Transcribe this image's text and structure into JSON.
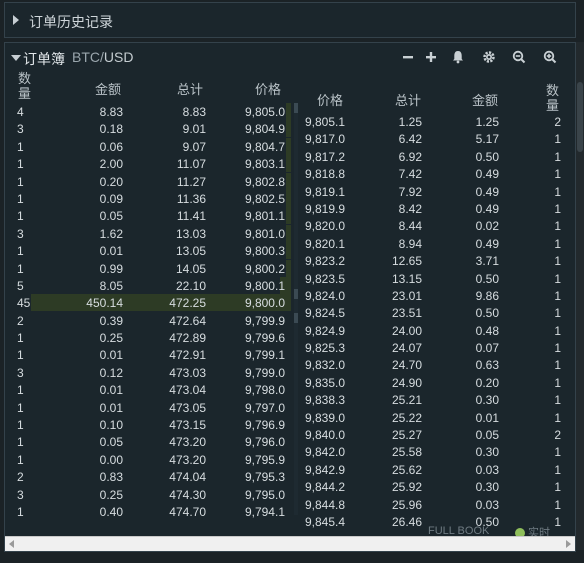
{
  "history": {
    "title": "订单历史记录"
  },
  "book": {
    "title": "订单簿",
    "pair_base": "BTC",
    "pair_sep": "/",
    "pair_quote": "USD",
    "tools": [
      "minus-icon",
      "plus-icon",
      "bell-icon",
      "gear-icon",
      "zoom-out-icon",
      "zoom-in-icon"
    ],
    "bid_headers": {
      "count": "数量",
      "amount": "金额",
      "total": "总计",
      "price": "价格"
    },
    "ask_headers": {
      "price": "价格",
      "total": "总计",
      "amount": "金额",
      "count": "数量"
    },
    "bids": [
      {
        "count": "4",
        "amount": "8.83",
        "total": "8.83",
        "price": "9,805.0",
        "bar": 0.02
      },
      {
        "count": "3",
        "amount": "0.18",
        "total": "9.01",
        "price": "9,804.9",
        "bar": 0.02
      },
      {
        "count": "1",
        "amount": "0.06",
        "total": "9.07",
        "price": "9,804.7",
        "bar": 0.02
      },
      {
        "count": "1",
        "amount": "2.00",
        "total": "11.07",
        "price": "9,803.1",
        "bar": 0.02
      },
      {
        "count": "1",
        "amount": "0.20",
        "total": "11.27",
        "price": "9,802.8",
        "bar": 0.02
      },
      {
        "count": "1",
        "amount": "0.09",
        "total": "11.36",
        "price": "9,802.5",
        "bar": 0.02
      },
      {
        "count": "1",
        "amount": "0.05",
        "total": "11.41",
        "price": "9,801.1",
        "bar": 0.02
      },
      {
        "count": "3",
        "amount": "1.62",
        "total": "13.03",
        "price": "9,801.0",
        "bar": 0.02
      },
      {
        "count": "1",
        "amount": "0.01",
        "total": "13.05",
        "price": "9,800.3",
        "bar": 0.02
      },
      {
        "count": "1",
        "amount": "0.99",
        "total": "14.05",
        "price": "9,800.2",
        "bar": 0.02
      },
      {
        "count": "5",
        "amount": "8.05",
        "total": "22.10",
        "price": "9,800.1",
        "bar": 0.04
      },
      {
        "count": "45",
        "amount": "450.14",
        "total": "472.25",
        "price": "9,800.0",
        "bar": 0.95
      },
      {
        "count": "2",
        "amount": "0.39",
        "total": "472.64",
        "price": "9,799.9",
        "bar": 0.0
      },
      {
        "count": "1",
        "amount": "0.25",
        "total": "472.89",
        "price": "9,799.6",
        "bar": 0.0
      },
      {
        "count": "1",
        "amount": "0.01",
        "total": "472.91",
        "price": "9,799.1",
        "bar": 0.0
      },
      {
        "count": "3",
        "amount": "0.12",
        "total": "473.03",
        "price": "9,799.0",
        "bar": 0.0
      },
      {
        "count": "1",
        "amount": "0.01",
        "total": "473.04",
        "price": "9,798.0",
        "bar": 0.0
      },
      {
        "count": "1",
        "amount": "0.01",
        "total": "473.05",
        "price": "9,797.0",
        "bar": 0.0
      },
      {
        "count": "1",
        "amount": "0.10",
        "total": "473.15",
        "price": "9,796.9",
        "bar": 0.0
      },
      {
        "count": "1",
        "amount": "0.05",
        "total": "473.20",
        "price": "9,796.0",
        "bar": 0.0
      },
      {
        "count": "1",
        "amount": "0.00",
        "total": "473.20",
        "price": "9,795.9",
        "bar": 0.0
      },
      {
        "count": "2",
        "amount": "0.83",
        "total": "474.04",
        "price": "9,795.3",
        "bar": 0.0
      },
      {
        "count": "3",
        "amount": "0.25",
        "total": "474.30",
        "price": "9,795.0",
        "bar": 0.0
      },
      {
        "count": "1",
        "amount": "0.40",
        "total": "474.70",
        "price": "9,794.1",
        "bar": 0.0
      }
    ],
    "asks": [
      {
        "price": "9,805.1",
        "total": "1.25",
        "amount": "1.25",
        "count": "2"
      },
      {
        "price": "9,817.0",
        "total": "6.42",
        "amount": "5.17",
        "count": "1"
      },
      {
        "price": "9,817.2",
        "total": "6.92",
        "amount": "0.50",
        "count": "1"
      },
      {
        "price": "9,818.8",
        "total": "7.42",
        "amount": "0.49",
        "count": "1"
      },
      {
        "price": "9,819.1",
        "total": "7.92",
        "amount": "0.49",
        "count": "1"
      },
      {
        "price": "9,819.9",
        "total": "8.42",
        "amount": "0.49",
        "count": "1"
      },
      {
        "price": "9,820.0",
        "total": "8.44",
        "amount": "0.02",
        "count": "1"
      },
      {
        "price": "9,820.1",
        "total": "8.94",
        "amount": "0.49",
        "count": "1"
      },
      {
        "price": "9,823.2",
        "total": "12.65",
        "amount": "3.71",
        "count": "1"
      },
      {
        "price": "9,823.5",
        "total": "13.15",
        "amount": "0.50",
        "count": "1"
      },
      {
        "price": "9,824.0",
        "total": "23.01",
        "amount": "9.86",
        "count": "1"
      },
      {
        "price": "9,824.5",
        "total": "23.51",
        "amount": "0.50",
        "count": "1"
      },
      {
        "price": "9,824.9",
        "total": "24.00",
        "amount": "0.48",
        "count": "1"
      },
      {
        "price": "9,825.3",
        "total": "24.07",
        "amount": "0.07",
        "count": "1"
      },
      {
        "price": "9,832.0",
        "total": "24.70",
        "amount": "0.63",
        "count": "1"
      },
      {
        "price": "9,835.0",
        "total": "24.90",
        "amount": "0.20",
        "count": "1"
      },
      {
        "price": "9,838.3",
        "total": "25.21",
        "amount": "0.30",
        "count": "1"
      },
      {
        "price": "9,839.0",
        "total": "25.22",
        "amount": "0.01",
        "count": "1"
      },
      {
        "price": "9,840.0",
        "total": "25.27",
        "amount": "0.05",
        "count": "2"
      },
      {
        "price": "9,842.0",
        "total": "25.58",
        "amount": "0.30",
        "count": "1"
      },
      {
        "price": "9,842.9",
        "total": "25.62",
        "amount": "0.03",
        "count": "1"
      },
      {
        "price": "9,844.2",
        "total": "25.92",
        "amount": "0.30",
        "count": "1"
      },
      {
        "price": "9,844.8",
        "total": "25.96",
        "amount": "0.03",
        "count": "1"
      },
      {
        "price": "9,845.4",
        "total": "26.46",
        "amount": "0.50",
        "count": "1"
      }
    ],
    "footer": {
      "full_book": "FULL BOOK",
      "live": "实时"
    },
    "colors": {
      "bid_bar": "#2d3b25",
      "live_dot": "#8fbf5b"
    }
  }
}
